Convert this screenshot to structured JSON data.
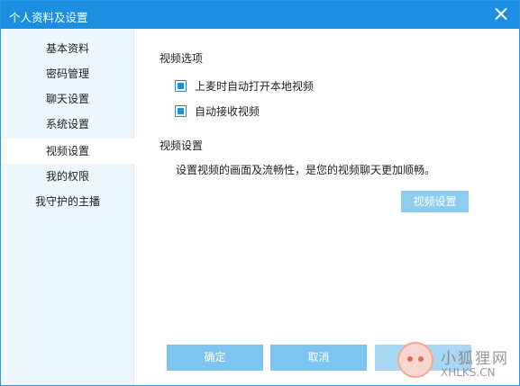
{
  "window": {
    "title": "个人资料及设置",
    "close_icon": "close-icon",
    "accent_color": "#1c8fe3"
  },
  "sidebar": {
    "items": [
      {
        "label": "基本资料",
        "active": false
      },
      {
        "label": "密码管理",
        "active": false
      },
      {
        "label": "聊天设置",
        "active": false
      },
      {
        "label": "系统设置",
        "active": false
      },
      {
        "label": "视频设置",
        "active": true
      },
      {
        "label": "我的权限",
        "active": false
      },
      {
        "label": "我守护的主播",
        "active": false
      }
    ]
  },
  "main": {
    "video_options": {
      "title": "视频选项",
      "checkboxes": [
        {
          "label": "上麦时自动打开本地视频",
          "checked": true
        },
        {
          "label": "自动接收视频",
          "checked": true
        }
      ]
    },
    "video_settings": {
      "title": "视频设置",
      "description": "设置视频的画面及流畅性，是您的视频聊天更加顺畅。",
      "button_label": "视频设置"
    }
  },
  "footer": {
    "ok_label": "确定",
    "cancel_label": "取消",
    "apply_label": "应用"
  },
  "watermark": {
    "name": "小狐狸网",
    "url": "XHLKS.CN"
  }
}
